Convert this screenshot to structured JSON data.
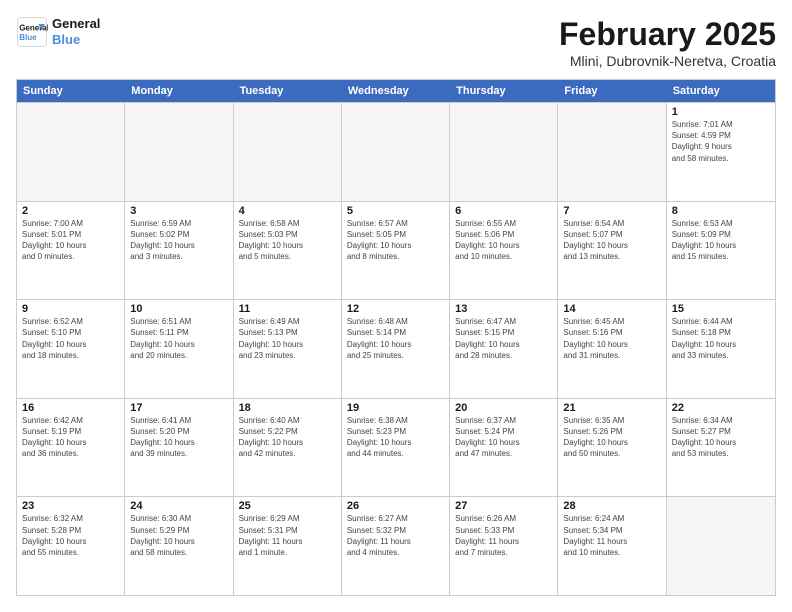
{
  "header": {
    "logo_line1": "General",
    "logo_line2": "Blue",
    "month_title": "February 2025",
    "location": "Mlini, Dubrovnik-Neretva, Croatia"
  },
  "days_of_week": [
    "Sunday",
    "Monday",
    "Tuesday",
    "Wednesday",
    "Thursday",
    "Friday",
    "Saturday"
  ],
  "weeks": [
    [
      {
        "day": "",
        "info": ""
      },
      {
        "day": "",
        "info": ""
      },
      {
        "day": "",
        "info": ""
      },
      {
        "day": "",
        "info": ""
      },
      {
        "day": "",
        "info": ""
      },
      {
        "day": "",
        "info": ""
      },
      {
        "day": "1",
        "info": "Sunrise: 7:01 AM\nSunset: 4:59 PM\nDaylight: 9 hours\nand 58 minutes."
      }
    ],
    [
      {
        "day": "2",
        "info": "Sunrise: 7:00 AM\nSunset: 5:01 PM\nDaylight: 10 hours\nand 0 minutes."
      },
      {
        "day": "3",
        "info": "Sunrise: 6:59 AM\nSunset: 5:02 PM\nDaylight: 10 hours\nand 3 minutes."
      },
      {
        "day": "4",
        "info": "Sunrise: 6:58 AM\nSunset: 5:03 PM\nDaylight: 10 hours\nand 5 minutes."
      },
      {
        "day": "5",
        "info": "Sunrise: 6:57 AM\nSunset: 5:05 PM\nDaylight: 10 hours\nand 8 minutes."
      },
      {
        "day": "6",
        "info": "Sunrise: 6:55 AM\nSunset: 5:06 PM\nDaylight: 10 hours\nand 10 minutes."
      },
      {
        "day": "7",
        "info": "Sunrise: 6:54 AM\nSunset: 5:07 PM\nDaylight: 10 hours\nand 13 minutes."
      },
      {
        "day": "8",
        "info": "Sunrise: 6:53 AM\nSunset: 5:09 PM\nDaylight: 10 hours\nand 15 minutes."
      }
    ],
    [
      {
        "day": "9",
        "info": "Sunrise: 6:52 AM\nSunset: 5:10 PM\nDaylight: 10 hours\nand 18 minutes."
      },
      {
        "day": "10",
        "info": "Sunrise: 6:51 AM\nSunset: 5:11 PM\nDaylight: 10 hours\nand 20 minutes."
      },
      {
        "day": "11",
        "info": "Sunrise: 6:49 AM\nSunset: 5:13 PM\nDaylight: 10 hours\nand 23 minutes."
      },
      {
        "day": "12",
        "info": "Sunrise: 6:48 AM\nSunset: 5:14 PM\nDaylight: 10 hours\nand 25 minutes."
      },
      {
        "day": "13",
        "info": "Sunrise: 6:47 AM\nSunset: 5:15 PM\nDaylight: 10 hours\nand 28 minutes."
      },
      {
        "day": "14",
        "info": "Sunrise: 6:45 AM\nSunset: 5:16 PM\nDaylight: 10 hours\nand 31 minutes."
      },
      {
        "day": "15",
        "info": "Sunrise: 6:44 AM\nSunset: 5:18 PM\nDaylight: 10 hours\nand 33 minutes."
      }
    ],
    [
      {
        "day": "16",
        "info": "Sunrise: 6:42 AM\nSunset: 5:19 PM\nDaylight: 10 hours\nand 36 minutes."
      },
      {
        "day": "17",
        "info": "Sunrise: 6:41 AM\nSunset: 5:20 PM\nDaylight: 10 hours\nand 39 minutes."
      },
      {
        "day": "18",
        "info": "Sunrise: 6:40 AM\nSunset: 5:22 PM\nDaylight: 10 hours\nand 42 minutes."
      },
      {
        "day": "19",
        "info": "Sunrise: 6:38 AM\nSunset: 5:23 PM\nDaylight: 10 hours\nand 44 minutes."
      },
      {
        "day": "20",
        "info": "Sunrise: 6:37 AM\nSunset: 5:24 PM\nDaylight: 10 hours\nand 47 minutes."
      },
      {
        "day": "21",
        "info": "Sunrise: 6:35 AM\nSunset: 5:26 PM\nDaylight: 10 hours\nand 50 minutes."
      },
      {
        "day": "22",
        "info": "Sunrise: 6:34 AM\nSunset: 5:27 PM\nDaylight: 10 hours\nand 53 minutes."
      }
    ],
    [
      {
        "day": "23",
        "info": "Sunrise: 6:32 AM\nSunset: 5:28 PM\nDaylight: 10 hours\nand 55 minutes."
      },
      {
        "day": "24",
        "info": "Sunrise: 6:30 AM\nSunset: 5:29 PM\nDaylight: 10 hours\nand 58 minutes."
      },
      {
        "day": "25",
        "info": "Sunrise: 6:29 AM\nSunset: 5:31 PM\nDaylight: 11 hours\nand 1 minute."
      },
      {
        "day": "26",
        "info": "Sunrise: 6:27 AM\nSunset: 5:32 PM\nDaylight: 11 hours\nand 4 minutes."
      },
      {
        "day": "27",
        "info": "Sunrise: 6:26 AM\nSunset: 5:33 PM\nDaylight: 11 hours\nand 7 minutes."
      },
      {
        "day": "28",
        "info": "Sunrise: 6:24 AM\nSunset: 5:34 PM\nDaylight: 11 hours\nand 10 minutes."
      },
      {
        "day": "",
        "info": ""
      }
    ]
  ]
}
